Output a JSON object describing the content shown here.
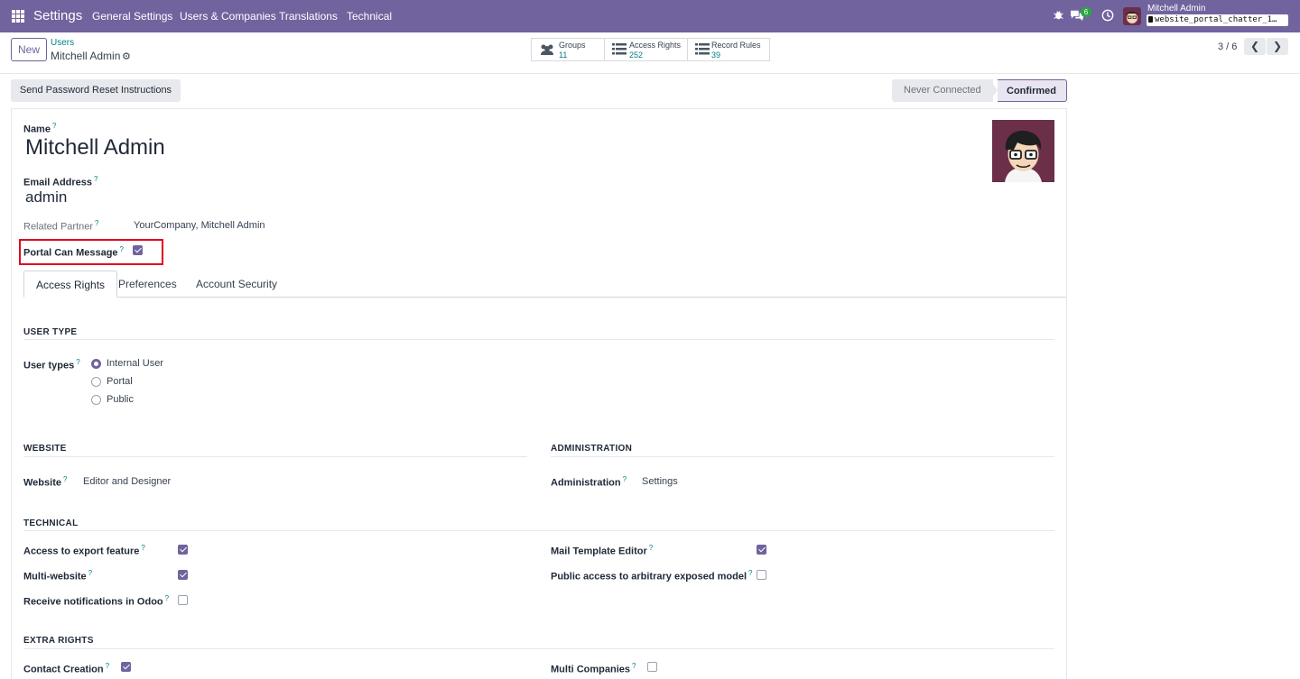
{
  "navbar": {
    "app_title": "Settings",
    "menus": [
      "General Settings",
      "Users & Companies",
      "Translations",
      "Technical"
    ],
    "chat_count": "6",
    "user_name": "Mitchell Admin",
    "db_name": "website_portal_chatter_1…",
    "icons": [
      "apps-grid-icon",
      "bug-icon",
      "chat-icon",
      "clock-icon"
    ]
  },
  "control_panel": {
    "new_label": "New",
    "breadcrumb_parent": "Users",
    "breadcrumb_current": "Mitchell Admin",
    "smart_buttons": [
      {
        "label": "Groups",
        "value": "11",
        "icon": "users-icon"
      },
      {
        "label": "Access Rights",
        "value": "252",
        "icon": "list-icon"
      },
      {
        "label": "Record Rules",
        "value": "39",
        "icon": "list-icon"
      }
    ],
    "pager": "3 / 6"
  },
  "statusbar": {
    "reset_label": "Send Password Reset Instructions",
    "stages": [
      "Never Connected",
      "Confirmed"
    ],
    "active_stage": "Confirmed"
  },
  "form": {
    "name_label": "Name",
    "name_value": "Mitchell Admin",
    "email_label": "Email Address",
    "email_value": "admin",
    "partner_label": "Related Partner",
    "partner_value": "YourCompany, Mitchell Admin",
    "portal_msg_label": "Portal Can Message",
    "portal_msg_checked": true,
    "help": "?"
  },
  "tabs": [
    "Access Rights",
    "Preferences",
    "Account Security"
  ],
  "access_rights": {
    "user_type_section": "USER TYPE",
    "user_types_label": "User types",
    "user_type_options": [
      "Internal User",
      "Portal",
      "Public"
    ],
    "user_type_selected": "Internal User",
    "website_section": "WEBSITE",
    "website_label": "Website",
    "website_value": "Editor and Designer",
    "admin_section": "ADMINISTRATION",
    "admin_label": "Administration",
    "admin_value": "Settings",
    "technical_section": "TECHNICAL",
    "technical_left": [
      {
        "label": "Access to export feature",
        "checked": true
      },
      {
        "label": "Multi-website",
        "checked": true
      },
      {
        "label": "Receive notifications in Odoo",
        "checked": false
      }
    ],
    "technical_right": [
      {
        "label": "Mail Template Editor",
        "checked": true
      },
      {
        "label": "Public access to arbitrary exposed model",
        "checked": false
      }
    ],
    "extra_section": "EXTRA RIGHTS",
    "extra_left": {
      "label": "Contact Creation",
      "checked": true
    },
    "extra_right": {
      "label": "Multi Companies",
      "checked": false
    }
  },
  "colors": {
    "brand": "#71639e",
    "link": "#017e84",
    "highlight": "#e0061e"
  }
}
